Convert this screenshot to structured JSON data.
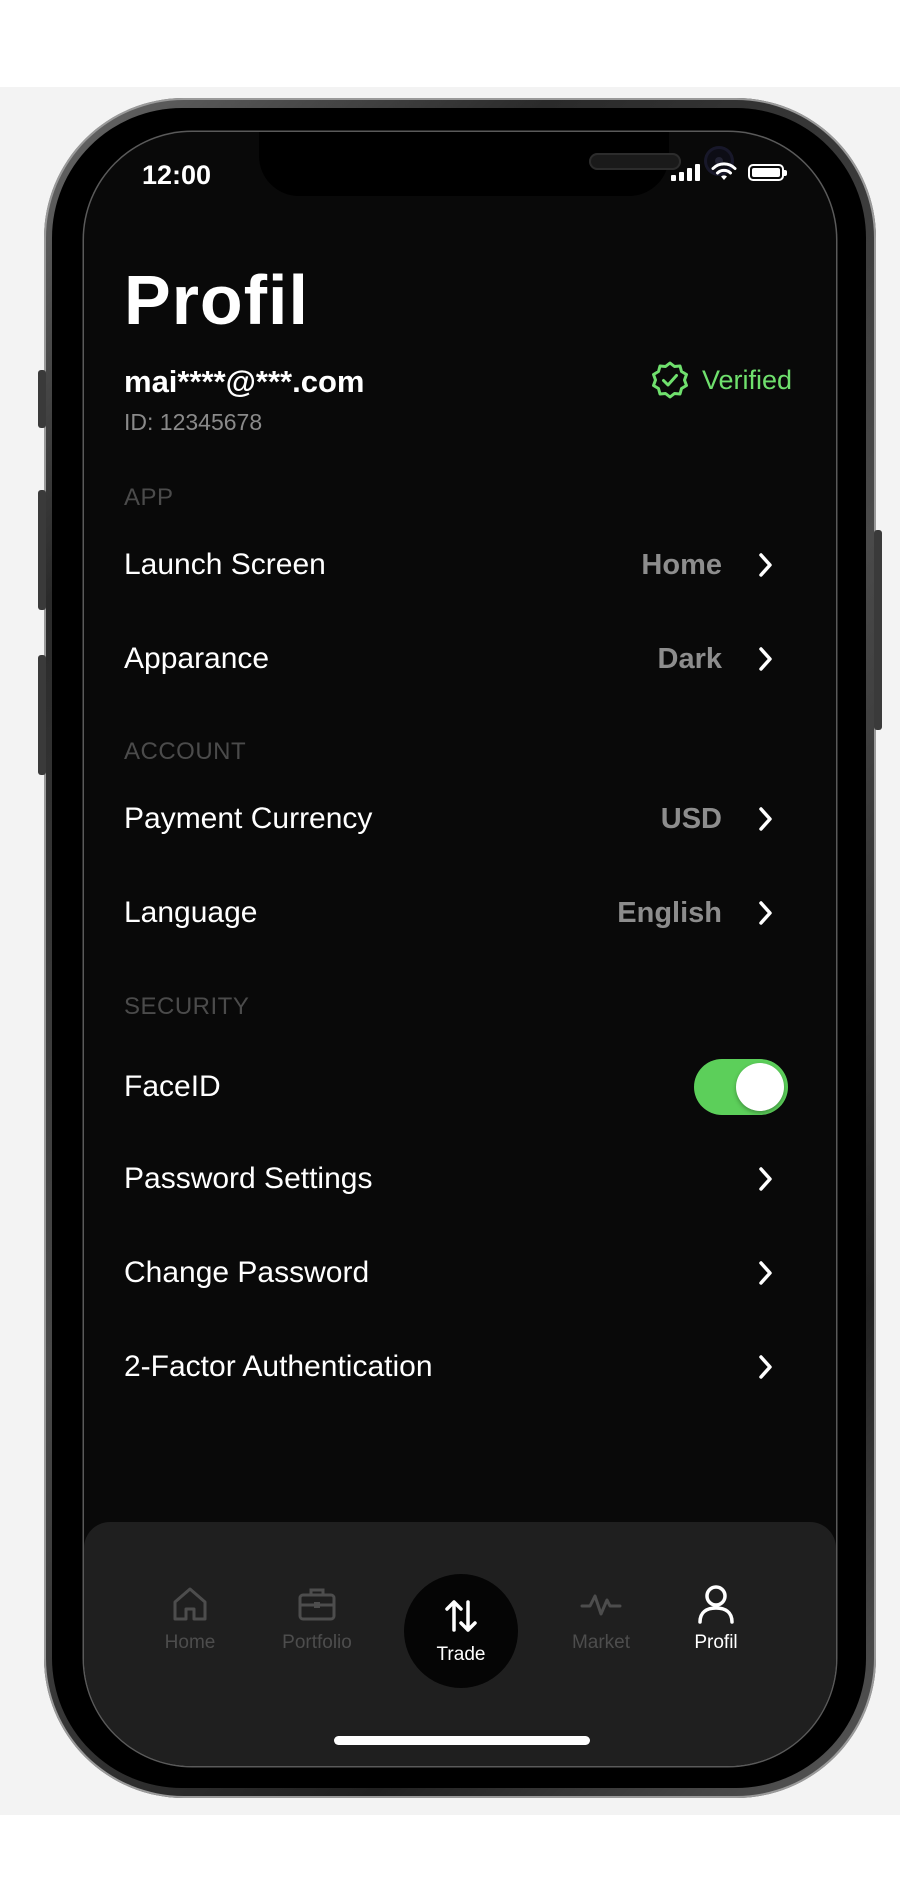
{
  "status_bar": {
    "time": "12:00"
  },
  "header": {
    "title": "Profil",
    "email": "mai****@***.com",
    "user_id": "ID: 12345678",
    "verified_label": "Verified",
    "verified_icon": "verified-badge-icon",
    "verified_color": "#6fe06d"
  },
  "sections": {
    "app": {
      "title": "APP",
      "launch_screen": {
        "label": "Launch Screen",
        "value": "Home"
      },
      "appearance": {
        "label": "Apparance",
        "value": "Dark"
      }
    },
    "account": {
      "title": "ACCOUNT",
      "payment_currency": {
        "label": "Payment Currency",
        "value": "USD"
      },
      "language": {
        "label": "Language",
        "value": "English"
      }
    },
    "security": {
      "title": "SECURITY",
      "faceid": {
        "label": "FaceID",
        "enabled": true,
        "toggle_color": "#5ccf5a"
      },
      "password_settings": {
        "label": "Password Settings"
      },
      "change_password": {
        "label": "Change Password"
      },
      "two_factor": {
        "label": "2-Factor Authentication"
      }
    }
  },
  "tab_bar": {
    "home": {
      "label": "Home",
      "icon": "home-icon"
    },
    "portfolio": {
      "label": "Portfolio",
      "icon": "briefcase-icon"
    },
    "trade": {
      "label": "Trade",
      "icon": "swap-arrows-icon"
    },
    "market": {
      "label": "Market",
      "icon": "activity-icon"
    },
    "profil": {
      "label": "Profil",
      "icon": "user-icon",
      "active": true
    }
  }
}
